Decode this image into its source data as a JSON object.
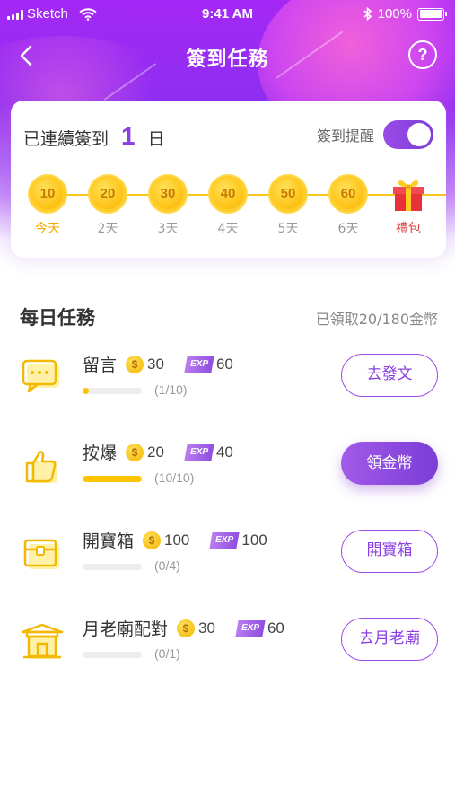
{
  "status_bar": {
    "carrier": "Sketch",
    "time": "9:41 AM",
    "battery": "100%"
  },
  "nav": {
    "title": "簽到任務",
    "help": "?"
  },
  "checkin": {
    "prefix": "已連續簽到",
    "days": "1",
    "suffix": "日",
    "reminder_label": "簽到提醒",
    "reminder_on": true,
    "schedule": [
      {
        "coins": "10",
        "label": "今天"
      },
      {
        "coins": "20",
        "label": "2天"
      },
      {
        "coins": "30",
        "label": "3天"
      },
      {
        "coins": "40",
        "label": "4天"
      },
      {
        "coins": "50",
        "label": "5天"
      },
      {
        "coins": "60",
        "label": "6天"
      },
      {
        "coins": "",
        "label": "禮包"
      }
    ]
  },
  "tasks_section": {
    "title": "每日任務",
    "claimed": "已領取20/180金幣"
  },
  "tasks": [
    {
      "name": "留言",
      "coins": "30",
      "exp_badge": "EXP",
      "exp": "60",
      "progress_text": "(1/10)",
      "progress": 0.1,
      "button": "去發文",
      "button_style": "outline"
    },
    {
      "name": "按爆",
      "coins": "20",
      "exp_badge": "EXP",
      "exp": "40",
      "progress_text": "(10/10)",
      "progress": 1.0,
      "button": "領金幣",
      "button_style": "filled"
    },
    {
      "name": "開寶箱",
      "coins": "100",
      "exp_badge": "EXP",
      "exp": "100",
      "progress_text": "(0/4)",
      "progress": 0,
      "button": "開寶箱",
      "button_style": "outline"
    },
    {
      "name": "月老廟配對",
      "coins": "30",
      "exp_badge": "EXP",
      "exp": "60",
      "progress_text": "(0/1)",
      "progress": 0,
      "button": "去月老廟",
      "button_style": "outline"
    }
  ],
  "colors": {
    "accent": "#8b3fe2",
    "coin": "#ffc51a",
    "gift_label": "#e23b3b"
  }
}
